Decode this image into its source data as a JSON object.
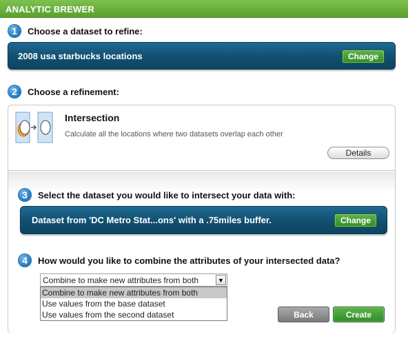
{
  "app": {
    "title": "ANALYTIC BREWER"
  },
  "steps": [
    {
      "number": "1",
      "label": "Choose a dataset to refine:"
    },
    {
      "number": "2",
      "label": "Choose a refinement:"
    },
    {
      "number": "3",
      "label": "Select the dataset you would like to intersect your data with:"
    },
    {
      "number": "4",
      "label": "How would you like to combine the attributes of your intersected data?"
    }
  ],
  "dataset": {
    "name": "2008 usa starbucks locations",
    "change_label": "Change"
  },
  "refinement": {
    "icon": "intersection-icon",
    "title": "Intersection",
    "description": "Calculate all the locations where two datasets overlap each other",
    "details_label": "Details"
  },
  "intersect_dataset": {
    "name": "Dataset from 'DC Metro Stat...ons' with a .75miles buffer.",
    "change_label": "Change"
  },
  "combine": {
    "selected": "Combine to make new attributes from both",
    "options": [
      "Combine to make new attributes from both",
      "Use values from the base dataset",
      "Use values from the second dataset"
    ]
  },
  "actions": {
    "back_label": "Back",
    "create_label": "Create"
  },
  "colors": {
    "brand_green": "#5aa02d",
    "bar_blue": "#124f70",
    "step_blue": "#2a7fc4"
  }
}
